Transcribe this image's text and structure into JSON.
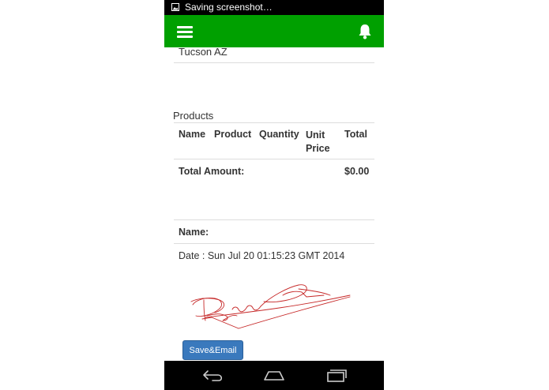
{
  "status_bar": {
    "notification_icon": "image-icon",
    "text": "Saving screenshot…"
  },
  "app_bar": {
    "menu_icon": "hamburger-menu-icon",
    "notification_icon": "bell-icon",
    "color": "#00a000"
  },
  "address": {
    "city_line": "Tucson AZ"
  },
  "products": {
    "section_title": "Products",
    "columns": [
      "Name",
      "Product",
      "Quantity",
      "Unit Price",
      "Total"
    ],
    "unit_price_lines": [
      "Unit",
      "Price"
    ],
    "total_label": "Total Amount:",
    "total_value": "$0.00"
  },
  "signer": {
    "name_label": "Name:",
    "date_text": "Date : Sun Jul 20 01:15:23 GMT 2014"
  },
  "signature": {
    "icon": "handwritten-signature",
    "ink_color": "#c62828"
  },
  "actions": {
    "save_email_label": "Save&Email",
    "button_color": "#3a79bd"
  },
  "nav_bar": {
    "back_icon": "back-icon",
    "home_icon": "home-icon",
    "recents_icon": "recents-icon"
  }
}
